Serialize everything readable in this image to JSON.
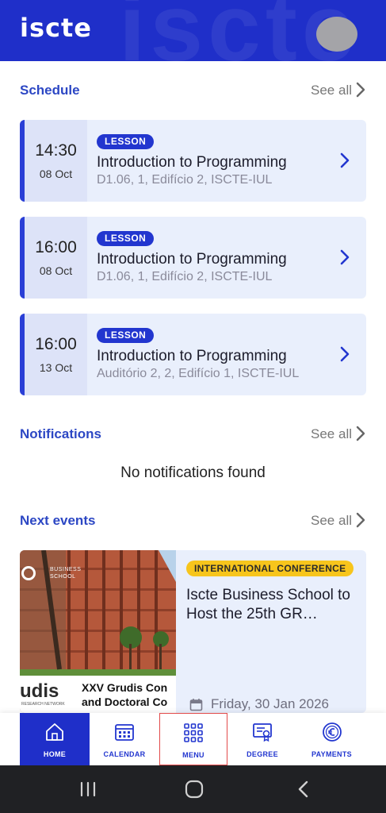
{
  "header": {
    "logo": "iscte",
    "watermark": "iscte"
  },
  "schedule": {
    "title": "Schedule",
    "see_all": "See all",
    "items": [
      {
        "time": "14:30",
        "date": "08 Oct",
        "badge": "LESSON",
        "title": "Introduction to Programming",
        "location": "D1.06, 1, Edifício 2, ISCTE-IUL"
      },
      {
        "time": "16:00",
        "date": "08 Oct",
        "badge": "LESSON",
        "title": "Introduction to Programming",
        "location": "D1.06, 1, Edifício 2, ISCTE-IUL"
      },
      {
        "time": "16:00",
        "date": "13 Oct",
        "badge": "LESSON",
        "title": "Introduction to Programming",
        "location": "Auditório 2, 2, Edifício 1, ISCTE-IUL"
      }
    ]
  },
  "notifications": {
    "title": "Notifications",
    "see_all": "See all",
    "empty_text": "No notifications found"
  },
  "events": {
    "title": "Next events",
    "see_all": "See all",
    "items": [
      {
        "badge": "INTERNATIONAL CONFERENCE",
        "title": "Iscte Business School to Host the 25th GR…",
        "date": "Friday, 30 Jan 2026",
        "image": {
          "brand_line1": "BUSINESS",
          "brand_line2": "SCHOOL",
          "logo_text": "udis",
          "logo_sub": "RESEARCH NETWORK",
          "caption_line1": "XXV Grudis Con",
          "caption_line2": "and Doctoral Co"
        }
      }
    ]
  },
  "tabbar": {
    "items": [
      {
        "label": "HOME",
        "icon": "home-icon",
        "active": true
      },
      {
        "label": "CALENDAR",
        "icon": "calendar-icon",
        "active": false
      },
      {
        "label": "MENU",
        "icon": "grid-menu-icon",
        "active": false,
        "highlighted": true
      },
      {
        "label": "DEGREE",
        "icon": "certificate-icon",
        "active": false
      },
      {
        "label": "PAYMENTS",
        "icon": "euro-coin-icon",
        "active": false
      }
    ]
  },
  "system_nav": {
    "buttons": [
      "recent-apps-icon",
      "home-circle-icon",
      "back-icon"
    ]
  },
  "colors": {
    "brand": "#1f2fc9",
    "accent_text": "#2c47c4",
    "card_bg": "#e9effc",
    "event_badge": "#f7c51c",
    "highlight_border": "#e24a4a"
  }
}
